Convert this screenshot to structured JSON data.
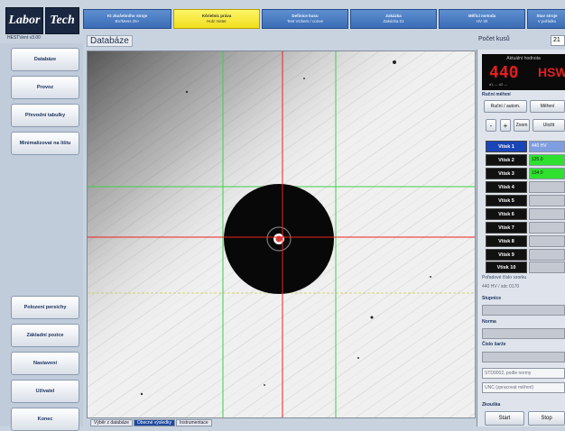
{
  "app": {
    "logo_part1": "Labor",
    "logo_part2": "Tech",
    "version": "HESTVent v3.00"
  },
  "steps": [
    {
      "title": "Kt zkušebního stroje",
      "sub": "BV/Mess 25+"
    },
    {
      "title": "Kôrielníc práva",
      "sub": "Holz meter"
    },
    {
      "title": "Definice kusu",
      "sub": "Test Vickers / conve"
    },
    {
      "title": "Zakázka",
      "sub": "Zakázka 01"
    },
    {
      "title": "Měřicí metoda",
      "sub": "HV 30"
    },
    {
      "title": "Stav stroje",
      "sub": "V pořádku"
    }
  ],
  "sidebar": {
    "items": [
      "Databáze",
      "Provoz",
      "Převodní tabulky",
      "Minimalizovat na lištu"
    ],
    "bottom_items": [
      "Polození persichy",
      "Základní pozice",
      "Nastavení",
      "Uživatel",
      "Konec"
    ]
  },
  "main": {
    "title": "Databáze",
    "bottom_tabs": [
      {
        "label": "Výběr z databáze",
        "active": false
      },
      {
        "label": "Obecné výsledky",
        "active": true
      },
      {
        "label": "Instrumentace",
        "active": false
      }
    ]
  },
  "right": {
    "count_label": "Počet kusů",
    "count_value": "21",
    "meas_label": "Aktuální hodnota",
    "meas_value": "440",
    "meas_unit": "HSW",
    "meas_sub": "d1 ---      d2 ---",
    "section_measure": "Ruční měření",
    "btn_manual": "Ruční / autom.",
    "btn_measure": "Měření",
    "btn_minus": "-",
    "btn_plus": "+",
    "btn_zoom": "Zoom",
    "btn_save": "Uložit",
    "vrows": [
      {
        "label": "Vtisk 1",
        "value": "440 HV",
        "state": "blue"
      },
      {
        "label": "Vtisk 2",
        "value": "125.0",
        "state": "green"
      },
      {
        "label": "Vtisk 3",
        "value": "134.0",
        "state": "green"
      },
      {
        "label": "Vtisk 4",
        "value": "",
        "state": "empty"
      },
      {
        "label": "Vtisk 5",
        "value": "",
        "state": "empty"
      },
      {
        "label": "Vtisk 6",
        "value": "",
        "state": "empty"
      },
      {
        "label": "Vtisk 7",
        "value": "",
        "state": "empty"
      },
      {
        "label": "Vtisk 8",
        "value": "",
        "state": "empty"
      },
      {
        "label": "Vtisk 9",
        "value": "",
        "state": "empty"
      },
      {
        "label": "Vtisk 10",
        "value": "",
        "state": "empty"
      }
    ],
    "series_label": "Pořadové číslo vzorku",
    "series_value": "440 HV / sdc 0170",
    "label_scale": "Stupnice",
    "label_norm": "Norma",
    "label_part": "Číslo šarže",
    "field_standard": "STD9002, podle normy",
    "field_unc": "UNC (zpracovat měření)",
    "section_sample": "Zkouška",
    "btn_start": "Start",
    "btn_stop": "Stop"
  }
}
